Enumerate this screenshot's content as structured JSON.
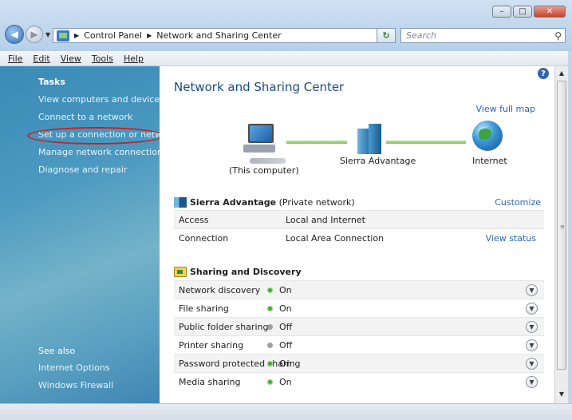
{
  "window": {
    "address_crumbs": [
      "Control Panel",
      "Network and Sharing Center"
    ],
    "search_placeholder": "Search"
  },
  "menu": [
    "File",
    "Edit",
    "View",
    "Tools",
    "Help"
  ],
  "sidebar": {
    "tasks_title": "Tasks",
    "tasks": [
      "View computers and devices",
      "Connect to a network",
      "Set up a connection or network",
      "Manage network connections",
      "Diagnose and repair"
    ],
    "see_also_title": "See also",
    "see_also": [
      "Internet Options",
      "Windows Firewall"
    ]
  },
  "main": {
    "title": "Network and Sharing Center",
    "view_full_map": "View full map",
    "map": {
      "computer_label": "(This computer)",
      "network_label": "Sierra Advantage",
      "internet_label": "Internet"
    },
    "network": {
      "name": "Sierra Advantage",
      "type": "(Private network)",
      "customize": "Customize",
      "rows": [
        {
          "label": "Access",
          "value": "Local and Internet",
          "link": ""
        },
        {
          "label": "Connection",
          "value": "Local Area Connection",
          "link": "View status"
        }
      ]
    },
    "sharing": {
      "title": "Sharing and Discovery",
      "rows": [
        {
          "label": "Network discovery",
          "status": "On"
        },
        {
          "label": "File sharing",
          "status": "On"
        },
        {
          "label": "Public folder sharing",
          "status": "Off"
        },
        {
          "label": "Printer sharing",
          "status": "Off"
        },
        {
          "label": "Password protected sharing",
          "status": "On"
        },
        {
          "label": "Media sharing",
          "status": "On"
        }
      ]
    }
  },
  "colors": {
    "on": "#40b030",
    "off": "#9aa0a6",
    "link": "#2a66b4",
    "highlight_ring": "#c8201f"
  }
}
